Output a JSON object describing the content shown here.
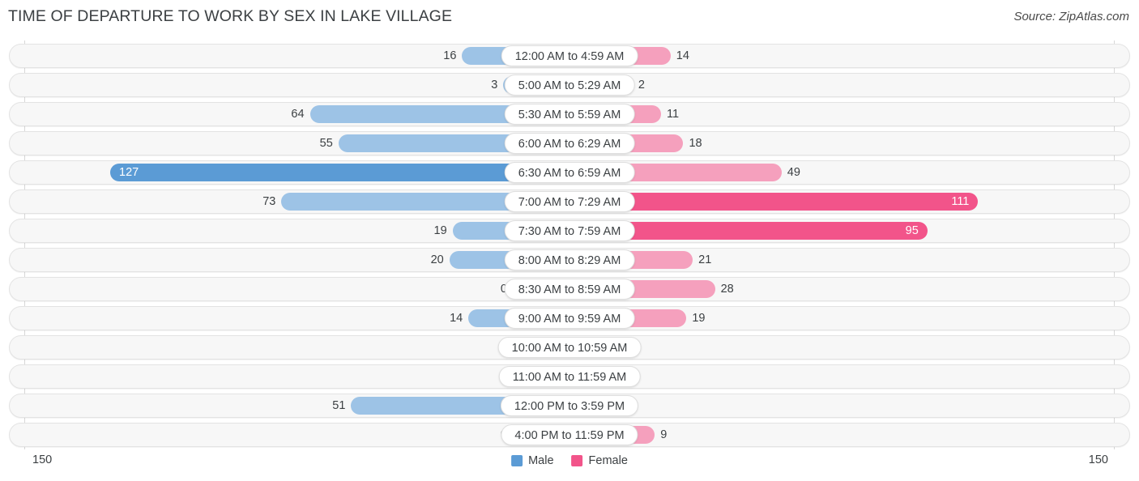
{
  "header": {
    "title": "TIME OF DEPARTURE TO WORK BY SEX IN LAKE VILLAGE",
    "source": "Source: ZipAtlas.com"
  },
  "axis": {
    "left_max_label": "150",
    "right_max_label": "150",
    "max": 150
  },
  "legend": {
    "items": [
      {
        "label": "Male",
        "color": "#5b9bd5"
      },
      {
        "label": "Female",
        "color": "#f2548a"
      }
    ]
  },
  "colors": {
    "male_light": "#9dc3e6",
    "male_dark": "#5b9bd5",
    "female_light": "#f5a0bd",
    "female_dark": "#f2548a",
    "track": "#f7f7f7",
    "track_border": "#e3e3e3",
    "text": "#3c4043"
  },
  "chart_data": {
    "type": "bar",
    "title": "TIME OF DEPARTURE TO WORK BY SEX IN LAKE VILLAGE",
    "subtitle": "",
    "xlabel": "",
    "ylabel": "",
    "orientation": "horizontal-diverging",
    "grid": false,
    "legend_position": "bottom-center",
    "xlim": [
      0,
      150
    ],
    "categories": [
      "12:00 AM to 4:59 AM",
      "5:00 AM to 5:29 AM",
      "5:30 AM to 5:59 AM",
      "6:00 AM to 6:29 AM",
      "6:30 AM to 6:59 AM",
      "7:00 AM to 7:29 AM",
      "7:30 AM to 7:59 AM",
      "8:00 AM to 8:29 AM",
      "8:30 AM to 8:59 AM",
      "9:00 AM to 9:59 AM",
      "10:00 AM to 10:59 AM",
      "11:00 AM to 11:59 AM",
      "12:00 PM to 3:59 PM",
      "4:00 PM to 11:59 PM"
    ],
    "series": [
      {
        "name": "Male",
        "color": "#5b9bd5",
        "values": [
          16,
          3,
          64,
          55,
          127,
          73,
          19,
          20,
          0,
          14,
          0,
          0,
          51,
          0
        ]
      },
      {
        "name": "Female",
        "color": "#f2548a",
        "values": [
          14,
          2,
          11,
          18,
          49,
          111,
          95,
          21,
          28,
          19,
          0,
          0,
          0,
          9
        ]
      }
    ]
  },
  "rows": [
    {
      "label": "12:00 AM to 4:59 AM",
      "male": "16",
      "female": "14"
    },
    {
      "label": "5:00 AM to 5:29 AM",
      "male": "3",
      "female": "2"
    },
    {
      "label": "5:30 AM to 5:59 AM",
      "male": "64",
      "female": "11"
    },
    {
      "label": "6:00 AM to 6:29 AM",
      "male": "55",
      "female": "18"
    },
    {
      "label": "6:30 AM to 6:59 AM",
      "male": "127",
      "female": "49"
    },
    {
      "label": "7:00 AM to 7:29 AM",
      "male": "73",
      "female": "111"
    },
    {
      "label": "7:30 AM to 7:59 AM",
      "male": "19",
      "female": "95"
    },
    {
      "label": "8:00 AM to 8:29 AM",
      "male": "20",
      "female": "21"
    },
    {
      "label": "8:30 AM to 8:59 AM",
      "male": "0",
      "female": "28"
    },
    {
      "label": "9:00 AM to 9:59 AM",
      "male": "14",
      "female": "19"
    },
    {
      "label": "10:00 AM to 10:59 AM",
      "male": "0",
      "female": "0"
    },
    {
      "label": "11:00 AM to 11:59 AM",
      "male": "0",
      "female": "0"
    },
    {
      "label": "12:00 PM to 3:59 PM",
      "male": "51",
      "female": "0"
    },
    {
      "label": "4:00 PM to 11:59 PM",
      "male": "0",
      "female": "9"
    }
  ]
}
